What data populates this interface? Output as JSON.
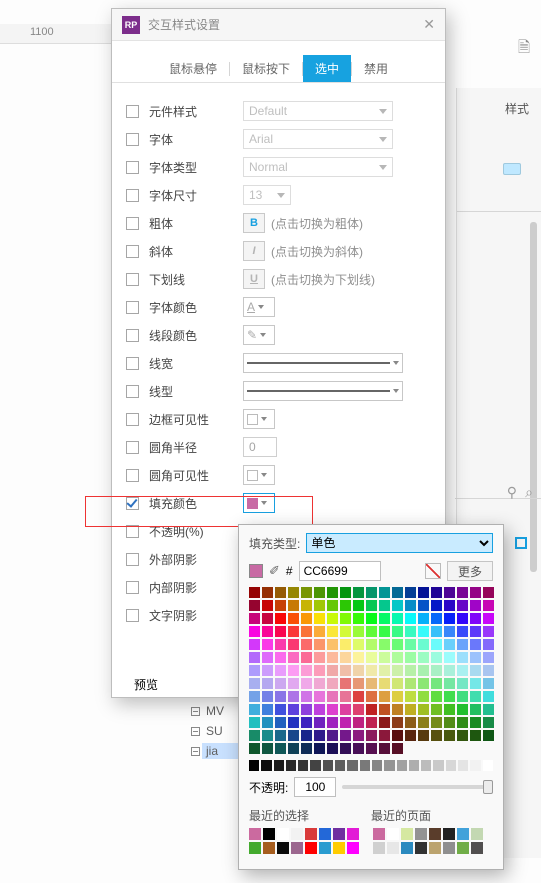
{
  "ruler_mark": "1100",
  "sidebar": {
    "tab": "样式"
  },
  "tree": {
    "items": [
      "MV",
      "SU"
    ],
    "selected": "jia"
  },
  "dialog": {
    "title": "交互样式设置",
    "tabs": {
      "hover": "鼠标悬停",
      "down": "鼠标按下",
      "selected": "选中",
      "disabled": "禁用"
    },
    "labels": {
      "style": "元件样式",
      "font": "字体",
      "font_type": "字体类型",
      "font_size": "字体尺寸",
      "bold": "粗体",
      "italic": "斜体",
      "underline": "下划线",
      "font_color": "字体颜色",
      "line_color": "线段颜色",
      "line_width": "线宽",
      "line_style": "线型",
      "border_vis": "边框可见性",
      "radius": "圆角半径",
      "corner_vis": "圆角可见性",
      "fill_color": "填充颜色",
      "opacity": "不透明(%)",
      "outer_shadow": "外部阴影",
      "inner_shadow": "内部阴影",
      "text_shadow": "文字阴影",
      "preview": "预览"
    },
    "hints": {
      "bold": "(点击切换为粗体)",
      "italic": "(点击切换为斜体)",
      "underline": "(点击切换为下划线)"
    },
    "values": {
      "style": "Default",
      "font": "Arial",
      "font_type": "Normal",
      "font_size": "13",
      "radius": "0"
    },
    "fill_swatch": "#c86aa4"
  },
  "color_picker": {
    "fill_type_label": "填充类型:",
    "fill_type_value": "单色",
    "swatch": "#c86aa4",
    "hex_value": "CC6699",
    "hex_prefix": "#",
    "more": "更多",
    "opacity_label": "不透明:",
    "opacity_value": "100",
    "recent_select_label": "最近的选择",
    "recent_page_label": "最近的页面",
    "recent_select": [
      "#cb6a9f",
      "#000000",
      "#ffffff",
      "#f2f2f2",
      "#d93a3a",
      "#2368d8",
      "#7030a0",
      "#e21bd6",
      "#43aa2e",
      "#a65d1e",
      "#0a0a0a",
      "#9c678f",
      "#ff0000",
      "#2a9cd0",
      "#ffcc00",
      "#ff00ff"
    ],
    "recent_page": [
      "#cb6a9f",
      "#ffffff",
      "#d5e8a1",
      "#939393",
      "#5a3d2b",
      "#222",
      "#42a2da",
      "#c3d8b2",
      "#d0d0d0",
      "#e7e7e7",
      "#2b8abf",
      "#323232",
      "#bba36e",
      "#8f8f8f",
      "#70ad47",
      "#514f4f"
    ]
  }
}
